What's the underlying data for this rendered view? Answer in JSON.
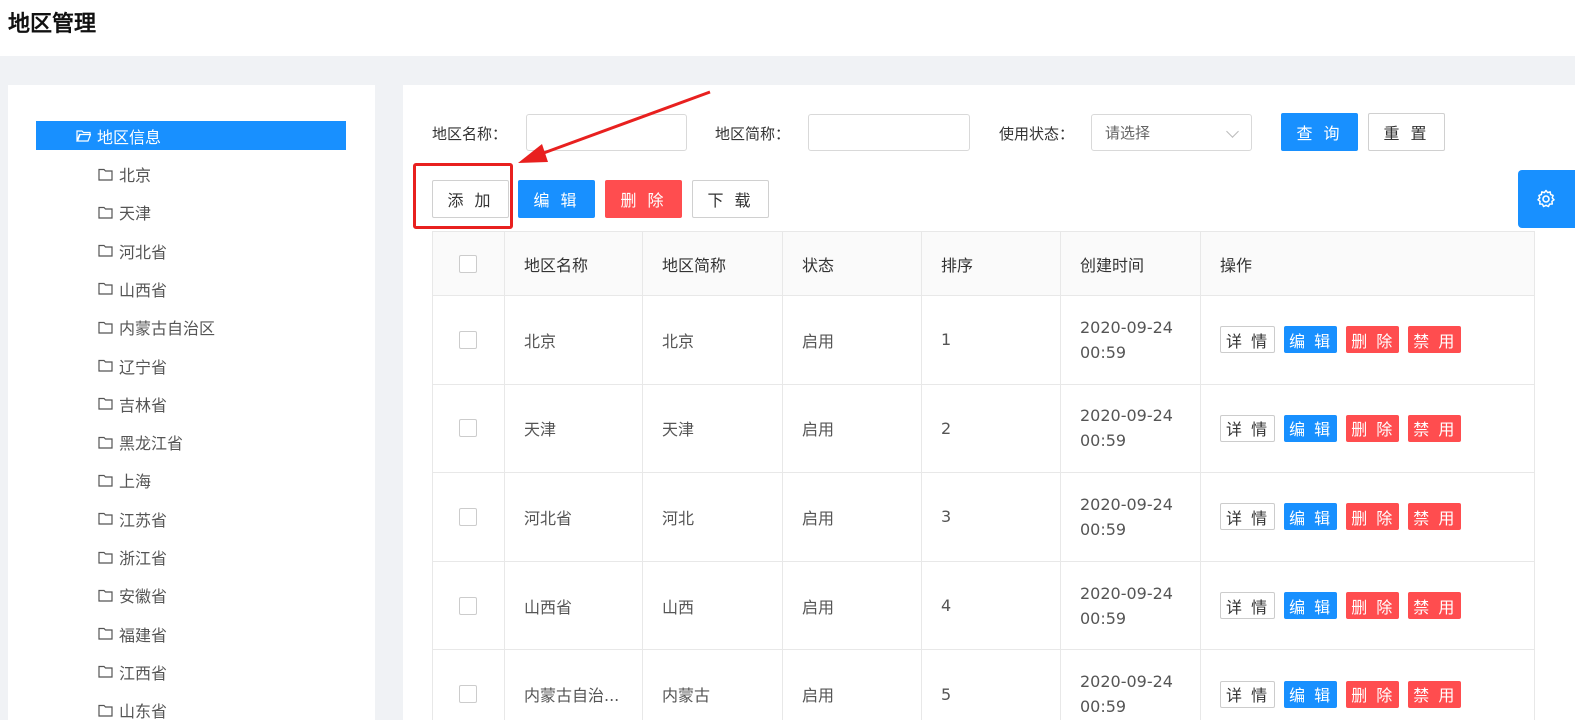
{
  "page": {
    "title": "地区管理"
  },
  "tree": {
    "root": "地区信息",
    "items": [
      "北京",
      "天津",
      "河北省",
      "山西省",
      "内蒙古自治区",
      "辽宁省",
      "吉林省",
      "黑龙江省",
      "上海",
      "江苏省",
      "浙江省",
      "安徽省",
      "福建省",
      "江西省",
      "山东省"
    ]
  },
  "search": {
    "name_label": "地区名称：",
    "abbr_label": "地区简称：",
    "status_label": "使用状态：",
    "name_value": "",
    "abbr_value": "",
    "status_placeholder": "请选择",
    "query_label": "查 询",
    "reset_label": "重 置"
  },
  "toolbar": {
    "add_label": "添 加",
    "edit_label": "编 辑",
    "delete_label": "删 除",
    "download_label": "下 载"
  },
  "table": {
    "headers": [
      "地区名称",
      "地区简称",
      "状态",
      "排序",
      "创建时间",
      "操作"
    ],
    "rows": [
      {
        "name": "北京",
        "abbr": "北京",
        "status": "启用",
        "order": "1",
        "date": "2020-09-24",
        "time": "00:59"
      },
      {
        "name": "天津",
        "abbr": "天津",
        "status": "启用",
        "order": "2",
        "date": "2020-09-24",
        "time": "00:59"
      },
      {
        "name": "河北省",
        "abbr": "河北",
        "status": "启用",
        "order": "3",
        "date": "2020-09-24",
        "time": "00:59"
      },
      {
        "name": "山西省",
        "abbr": "山西",
        "status": "启用",
        "order": "4",
        "date": "2020-09-24",
        "time": "00:59"
      },
      {
        "name": "内蒙古自治...",
        "abbr": "内蒙古",
        "status": "启用",
        "order": "5",
        "date": "2020-09-24",
        "time": "00:59"
      }
    ],
    "actions": {
      "detail": "详 情",
      "edit": "编 辑",
      "delete": "删 除",
      "disable": "禁 用"
    }
  },
  "colors": {
    "primary": "#1890ff",
    "danger": "#ff4d4f",
    "annotation": "#e8201f"
  },
  "icons": {
    "tree": "folder-icon",
    "settings": "gear-icon"
  }
}
